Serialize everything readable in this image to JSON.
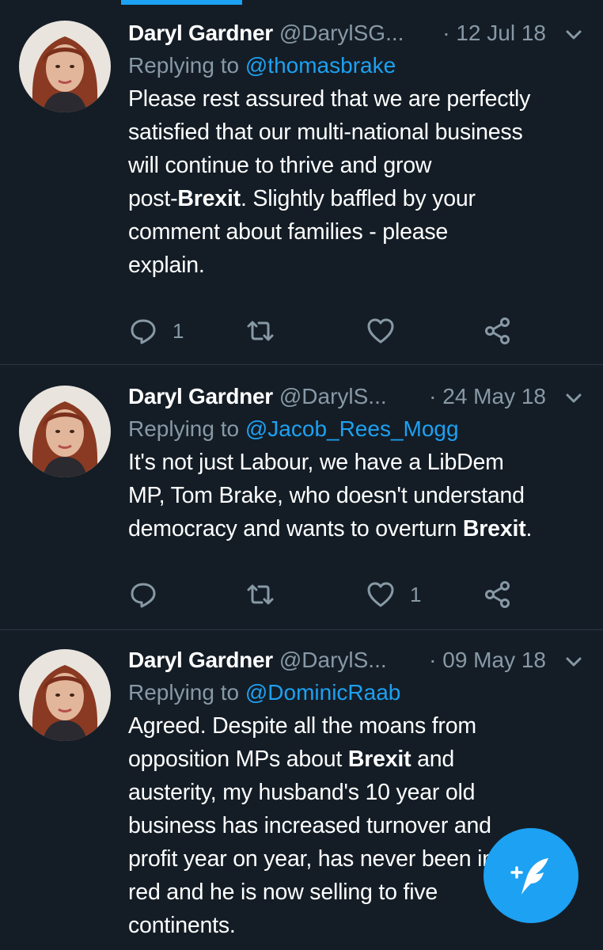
{
  "colors": {
    "background": "#141d26",
    "accent": "#1da1f2",
    "muted": "#8899a6",
    "divider": "#2a3744"
  },
  "tweets": [
    {
      "name": "Daryl Gardner",
      "handle": "@DarylSG...",
      "date": "· 12 Jul 18",
      "replying_prefix": "Replying to ",
      "replying_to": "@thomasbrake",
      "segments": [
        {
          "text": "Please rest assured that we are perfectly\nsatisfied that our multi-national business\nwill continue to thrive and grow\npost-",
          "bold": false
        },
        {
          "text": "Brexit",
          "bold": true
        },
        {
          "text": ". Slightly baffled by your\ncomment about families - please\nexplain.",
          "bold": false
        }
      ],
      "reply_count": "1",
      "like_count": ""
    },
    {
      "name": "Daryl Gardner",
      "handle": "@DarylS...",
      "date": "· 24 May 18",
      "replying_prefix": "Replying to ",
      "replying_to": "@Jacob_Rees_Mogg",
      "segments": [
        {
          "text": "It's not just Labour, we have a LibDem\nMP, Tom Brake, who doesn't understand\ndemocracy and wants to overturn ",
          "bold": false
        },
        {
          "text": "Brexit",
          "bold": true
        },
        {
          "text": ".",
          "bold": false
        }
      ],
      "reply_count": "",
      "like_count": "1"
    },
    {
      "name": "Daryl Gardner",
      "handle": "@DarylS...",
      "date": "· 09 May 18",
      "replying_prefix": "Replying to ",
      "replying_to": "@DominicRaab",
      "segments": [
        {
          "text": "Agreed. Despite all the moans from\nopposition MPs about ",
          "bold": false
        },
        {
          "text": "Brexit",
          "bold": true
        },
        {
          "text": " and\nausterity, my husband's 10 year old\nbusiness has increased turnover and\nprofit year on year, has never been in\nred and he is now selling to five\ncontinents.",
          "bold": false
        }
      ],
      "reply_count": "",
      "like_count": ""
    }
  ],
  "icons": {
    "reply": "reply-icon",
    "retweet": "retweet-icon",
    "like": "like-icon",
    "share": "share-icon",
    "compose": "compose-tweet-icon",
    "more": "chevron-down-icon"
  }
}
